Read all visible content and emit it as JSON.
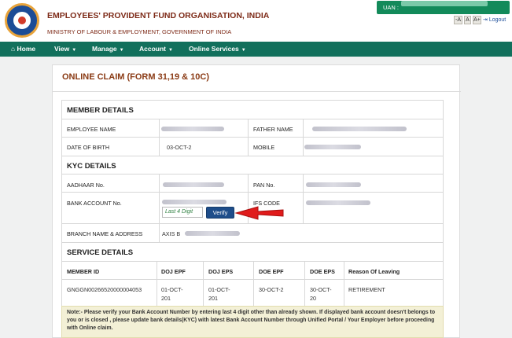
{
  "header": {
    "org_name": "EMPLOYEES' PROVIDENT FUND ORGANISATION, INDIA",
    "ministry": "MINISTRY OF LABOUR & EMPLOYMENT, GOVERNMENT OF INDIA",
    "uan_label": "UAN :",
    "font_sizes": [
      "-A",
      "A",
      "A+"
    ],
    "logout": "Logout"
  },
  "nav": {
    "home": "Home",
    "view": "View",
    "manage": "Manage",
    "account": "Account",
    "online_services": "Online Services"
  },
  "page": {
    "title": "ONLINE CLAIM (FORM 31,19 & 10C)"
  },
  "member_details": {
    "heading": "MEMBER DETAILS",
    "employee_name_label": "EMPLOYEE NAME",
    "father_name_label": "FATHER NAME",
    "dob_label": "DATE OF BIRTH",
    "dob_value": "03-OCT-2",
    "mobile_label": "MOBILE"
  },
  "kyc_details": {
    "heading": "KYC DETAILS",
    "aadhaar_label": "AADHAAR No.",
    "pan_label": "PAN No.",
    "bank_account_label": "BANK ACCOUNT No.",
    "ifs_label": "IFS CODE",
    "last4_placeholder": "Last 4 Digit",
    "verify_label": "Verify",
    "branch_label": "BRANCH NAME & ADDRESS",
    "branch_value": "AXIS B"
  },
  "service_details": {
    "heading": "SERVICE DETAILS",
    "columns": [
      "MEMBER ID",
      "DOJ EPF",
      "DOJ EPS",
      "DOE EPF",
      "DOE EPS",
      "Reason Of Leaving"
    ],
    "row": {
      "member_id": "GNGGN00266520000004053",
      "doj_epf_1": "01-OCT-",
      "doj_epf_2": "201",
      "doj_eps_1": "01-OCT-",
      "doj_eps_2": "201",
      "doe_epf": "30-OCT-2",
      "doe_eps_1": "30-OCT-",
      "doe_eps_2": "20",
      "reason": "RETIREMENT"
    }
  },
  "note": {
    "text": "Note:- Please verify your Bank Account Number by entering last 4 digit other than already shown. If displayed bank account doesn't belongs to you or is closed , please update bank details(KYC) with latest Bank Account Number through Unified Portal / Your Employer before proceeding with Online claim."
  },
  "colors": {
    "nav_bg": "#12705c",
    "uan_bg": "#138a5a",
    "title_color": "#8a3a14",
    "verify_bg": "#1e4d8a",
    "arrow": "#e01b1b",
    "note_bg": "#f3f0d6"
  }
}
